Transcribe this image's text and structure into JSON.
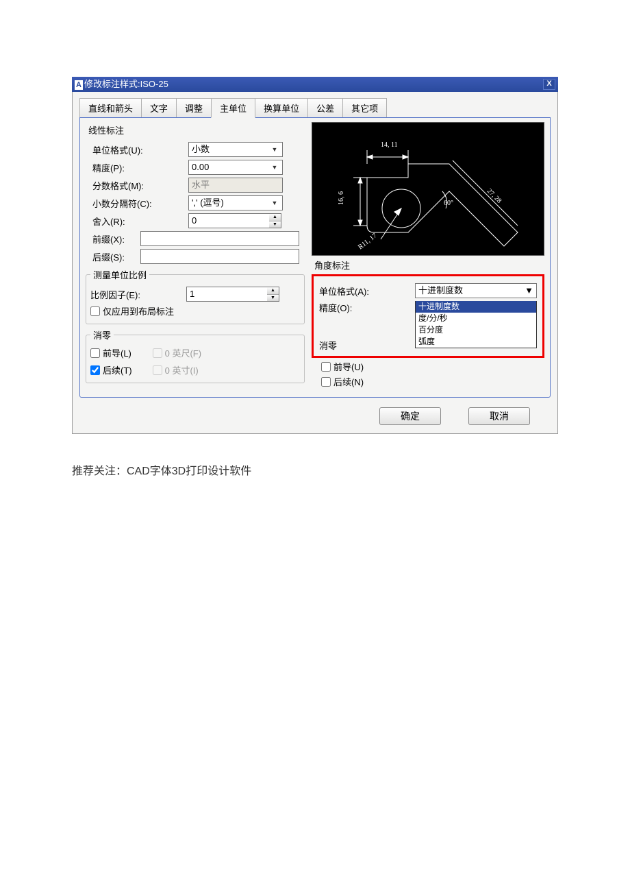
{
  "titlebar": {
    "prefix": "A",
    "title": "修改标注样式:ISO-25",
    "close": "X"
  },
  "tabs": [
    "直线和箭头",
    "文字",
    "调整",
    "主单位",
    "换算单位",
    "公差",
    "其它项"
  ],
  "active_tab": 3,
  "linear": {
    "group": "线性标注",
    "unit_format_label": "单位格式(U):",
    "unit_format_value": "小数",
    "precision_label": "精度(P):",
    "precision_value": "0.00",
    "fraction_label": "分数格式(M):",
    "fraction_value": "水平",
    "decimal_sep_label": "小数分隔符(C):",
    "decimal_sep_value": "',' (逗号)",
    "round_label": "舍入(R):",
    "round_value": "0",
    "prefix_label": "前缀(X):",
    "prefix_value": "",
    "suffix_label": "后缀(S):",
    "suffix_value": ""
  },
  "scale": {
    "group": "测量单位比例",
    "factor_label": "比例因子(E):",
    "factor_value": "1",
    "layout_only": "仅应用到布局标注"
  },
  "zero_left": {
    "group": "消零",
    "leading": "前导(L)",
    "trailing": "后续(T)",
    "feet": "0 英尺(F)",
    "inches": "0 英寸(I)"
  },
  "preview": {
    "dim1": "14, 11",
    "dim2": "16, 6",
    "dim3": "27, 28",
    "angle": "60°",
    "radius": "R11, 17"
  },
  "angle": {
    "group": "角度标注",
    "unit_format_label": "单位格式(A):",
    "unit_format_value": "十进制度数",
    "precision_label": "精度(O):",
    "options": [
      "十进制度数",
      "度/分/秒",
      "百分度",
      "弧度"
    ],
    "zero_group": "消零",
    "leading": "前导(U)",
    "trailing": "后续(N)"
  },
  "buttons": {
    "ok": "确定",
    "cancel": "取消"
  },
  "footer": "推荐关注：CAD字体3D打印设计软件"
}
